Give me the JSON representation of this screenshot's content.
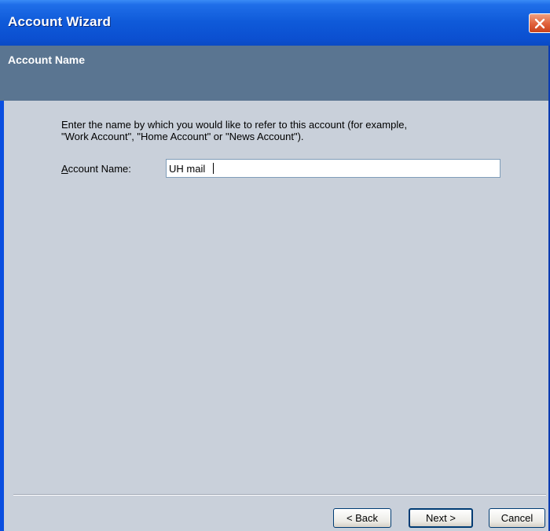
{
  "window": {
    "title": "Account Wizard"
  },
  "header": {
    "title": "Account Name"
  },
  "intro": {
    "line1": "Enter the name by which you would like to refer to this account (for example,",
    "line2": "\"Work Account\", \"Home Account\" or \"News Account\")."
  },
  "field": {
    "label_accel": "A",
    "label_rest": "ccount Name:",
    "value": "UH mail"
  },
  "buttons": {
    "back": "< Back",
    "next": "Next >",
    "cancel": "Cancel"
  },
  "colors": {
    "titlebar": "#0b4fd0",
    "header_band": "#5a7591",
    "client": "#c9d0da",
    "close": "#e0603a"
  },
  "icons": {
    "close": "close-icon"
  }
}
